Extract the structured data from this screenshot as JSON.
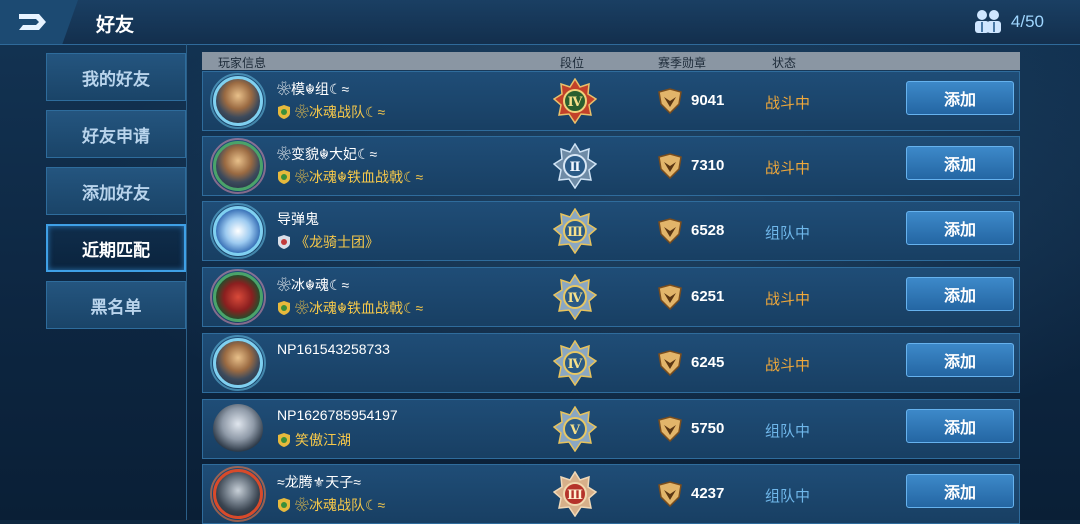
{
  "header": {
    "title": "好友",
    "friend_count": "4/50"
  },
  "sidebar": {
    "items": [
      {
        "label": "我的好友",
        "active": false
      },
      {
        "label": "好友申请",
        "active": false
      },
      {
        "label": "添加好友",
        "active": false
      },
      {
        "label": "近期匹配",
        "active": true
      },
      {
        "label": "黑名单",
        "active": false
      }
    ]
  },
  "table": {
    "columns": [
      "玩家信息",
      "段位",
      "赛季勋章",
      "状态"
    ],
    "rows": [
      {
        "name": "❀模☬组☾≈",
        "guild": "❀冰魂战队☾≈",
        "rank": "Ⅳ",
        "medals": "9041",
        "status": "战斗中",
        "action": "添加"
      },
      {
        "name": "❀变貌☬大妃☾≈",
        "guild": "❀冰魂☬铁血战戟☾≈",
        "rank": "Ⅱ",
        "medals": "7310",
        "status": "战斗中",
        "action": "添加"
      },
      {
        "name": "导弹鬼",
        "guild": "《龙骑士团》",
        "rank": "Ⅲ",
        "medals": "6528",
        "status": "组队中",
        "action": "添加"
      },
      {
        "name": "❀冰☬魂☾≈",
        "guild": "❀冰魂☬铁血战戟☾≈",
        "rank": "Ⅳ",
        "medals": "6251",
        "status": "战斗中",
        "action": "添加"
      },
      {
        "name": "NP161543258733",
        "guild": "",
        "rank": "Ⅳ",
        "medals": "6245",
        "status": "战斗中",
        "action": "添加"
      },
      {
        "name": "NP1626785954197",
        "guild": "笑傲江湖",
        "rank": "Ⅴ",
        "medals": "5750",
        "status": "组队中",
        "action": "添加"
      },
      {
        "name": "≈龙腾⚜天子≈",
        "guild": "❀冰魂战队☾≈",
        "rank": "Ⅲ",
        "medals": "4237",
        "status": "组队中",
        "action": "添加"
      }
    ]
  },
  "colors": {
    "status_fighting": "#f0a83a",
    "status_team": "#6fb7ea",
    "guild_text": "#f6c84a",
    "button": "#2f78b8"
  }
}
